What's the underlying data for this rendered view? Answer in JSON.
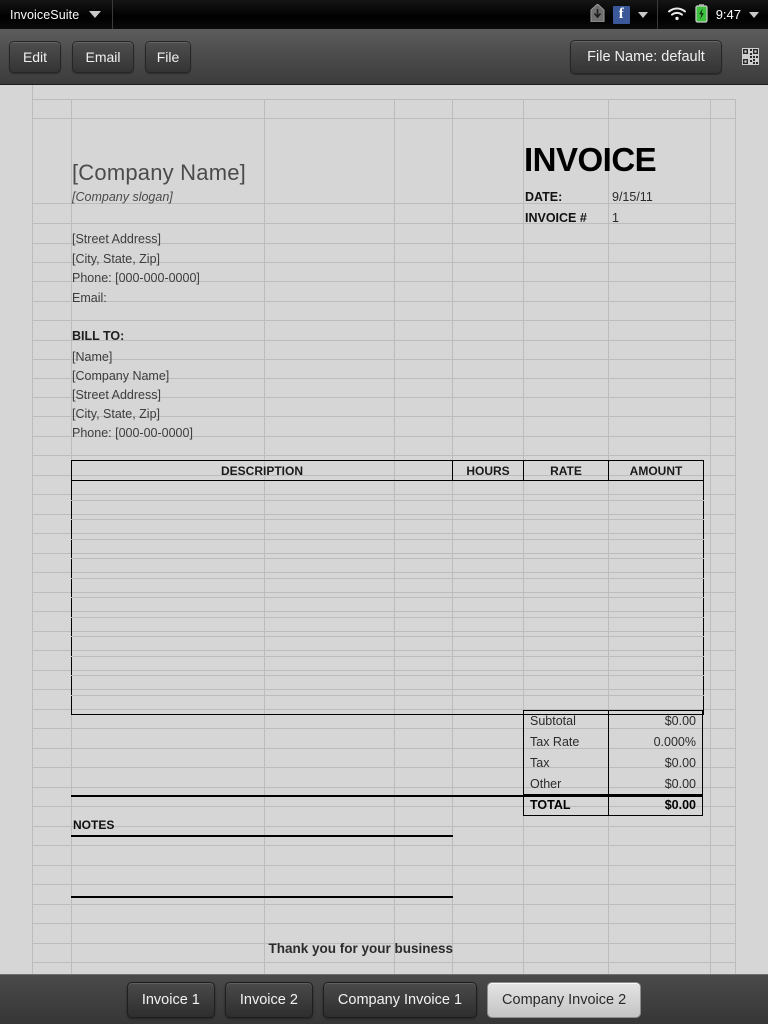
{
  "statusbar": {
    "app_name": "InvoiceSuite",
    "app_caret": "chevron-down-icon",
    "download_icon": "download-icon",
    "facebook_icon": "facebook-icon",
    "facebook_letter": "f",
    "tray_caret": "chevron-down-icon",
    "wifi_icon": "wifi-icon",
    "battery_icon": "battery-charging-icon",
    "time": "9:47",
    "right_caret": "chevron-down-icon"
  },
  "toolbar": {
    "edit_label": "Edit",
    "email_label": "Email",
    "file_label": "File",
    "filename_label": "File Name: default",
    "qr_icon": "qr-code-icon"
  },
  "invoice": {
    "company_name": "[Company Name]",
    "company_slogan": "[Company slogan]",
    "company_street": "[Street Address]",
    "company_city": "[City, State,  Zip]",
    "company_phone": "Phone: [000-000-0000]",
    "company_email": "Email:",
    "title": "INVOICE",
    "date_label": "DATE:",
    "date_value": "9/15/11",
    "number_label": "INVOICE #",
    "number_value": "1",
    "bill_to_label": "BILL TO:",
    "bill_to_name": "[Name]",
    "bill_to_company": "[Company Name]",
    "bill_to_street": "[Street Address]",
    "bill_to_city": "[City, State,  Zip]",
    "bill_to_phone": "Phone: [000-00-0000]",
    "notes_label": "NOTES",
    "footer_message": "Thank you for your business"
  },
  "line_items": {
    "columns": [
      "DESCRIPTION",
      "HOURS",
      "RATE",
      "AMOUNT"
    ],
    "row_count": 12,
    "rows": []
  },
  "totals": {
    "rows": [
      {
        "label": "Subtotal",
        "value": "$0.00"
      },
      {
        "label": "Tax Rate",
        "value": "0.000%"
      },
      {
        "label": "Tax",
        "value": "$0.00"
      },
      {
        "label": "Other",
        "value": "$0.00"
      }
    ],
    "total_label": "TOTAL",
    "total_value": "$0.00"
  },
  "tabbar": {
    "tabs": [
      {
        "label": "Invoice 1",
        "active": false
      },
      {
        "label": "Invoice 2",
        "active": false
      },
      {
        "label": "Company Invoice 1",
        "active": false
      },
      {
        "label": "Company Invoice 2",
        "active": true
      }
    ]
  },
  "colors": {
    "sheet_background": "#d6d6d6",
    "gridline": "#bcbcbc",
    "statusbar_background": "#000000",
    "toolbar_background": "#4c4c4c",
    "facebook_blue": "#3b5998",
    "battery_green": "#3ec13e",
    "active_tab_background": "#d8d8d8"
  }
}
